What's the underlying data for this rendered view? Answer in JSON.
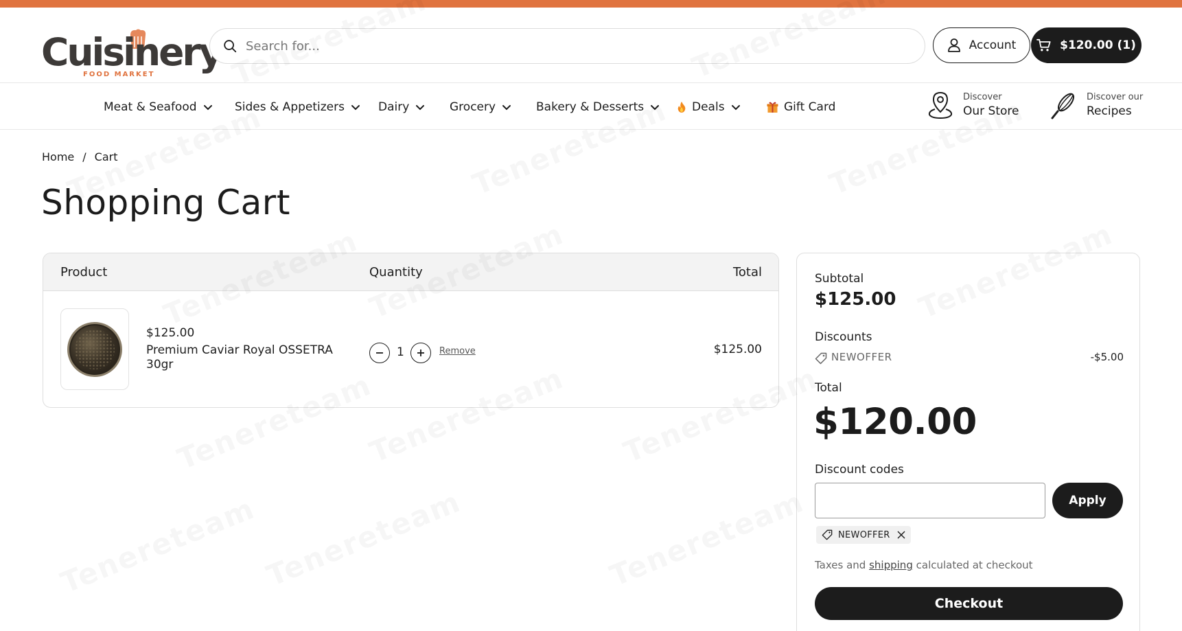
{
  "brand": {
    "name": "Cuisinery",
    "tagline": "FOOD MARKET",
    "accent_color": "#e0733f",
    "dark_color": "#1c1c1c"
  },
  "header": {
    "search_placeholder": "Search for...",
    "account_label": "Account",
    "cart_label": "$120.00 (1)"
  },
  "nav": {
    "items": [
      {
        "label": "Meat & Seafood",
        "icon": "chevron-down-icon"
      },
      {
        "label": "Sides & Appetizers",
        "icon": "chevron-down-icon"
      },
      {
        "label": "Dairy",
        "icon": "chevron-down-icon"
      },
      {
        "label": "Grocery",
        "icon": "chevron-down-icon"
      },
      {
        "label": "Bakery & Desserts",
        "icon": "chevron-down-icon"
      },
      {
        "label": "Deals",
        "icon": "chevron-down-icon",
        "lead_icon": "fire-icon"
      },
      {
        "label": "Gift Card",
        "lead_icon": "gift-icon"
      }
    ],
    "discover_store": {
      "small": "Discover",
      "big": "Our Store",
      "icon": "map-pin-icon"
    },
    "discover_recipes": {
      "small": "Discover our",
      "big": "Recipes",
      "icon": "whisk-icon"
    }
  },
  "breadcrumb": {
    "home": "Home",
    "separator": "/",
    "current": "Cart"
  },
  "page_title": "Shopping Cart",
  "cart": {
    "columns": {
      "product": "Product",
      "quantity": "Quantity",
      "total": "Total"
    },
    "items": [
      {
        "unit_price": "$125.00",
        "name": "Premium Caviar Royal OSSETRA 30gr",
        "quantity": "1",
        "remove_label": "Remove",
        "line_total": "$125.00"
      }
    ]
  },
  "summary": {
    "subtotal_label": "Subtotal",
    "subtotal_value": "$125.00",
    "discounts_label": "Discounts",
    "discount_code": "NEWOFFER",
    "discount_amount": "-$5.00",
    "total_label": "Total",
    "total_value": "$120.00",
    "discount_codes_label": "Discount codes",
    "discount_input_value": "",
    "apply_label": "Apply",
    "applied_chip": "NEWOFFER",
    "taxes_before": "Taxes and",
    "taxes_link": "shipping",
    "taxes_after": "calculated at checkout",
    "checkout_label": "Checkout"
  },
  "watermark": {
    "text": "Tenereteam"
  }
}
